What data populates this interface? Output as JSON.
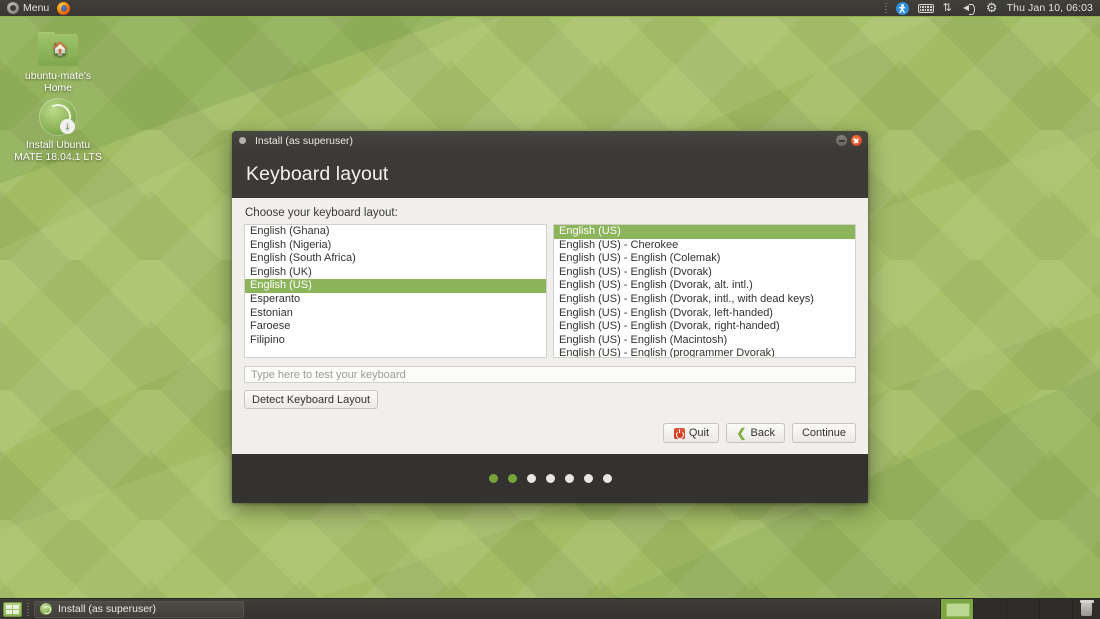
{
  "top_panel": {
    "menu_label": "Menu",
    "menu_icon": "mate-menu-icon",
    "firefox_icon": "firefox-icon",
    "tray": {
      "accessibility_icon": "accessibility-icon",
      "keyboard_icon": "keyboard-indicator-icon",
      "network_icon": "network-updown-icon",
      "volume_icon": "volume-icon",
      "settings_icon": "settings-gear-icon"
    },
    "clock": "Thu Jan 10, 06:03"
  },
  "desktop_icons": [
    {
      "name": "home-folder",
      "icon": "folder-home-icon",
      "label_line1": "ubuntu-mate's",
      "label_line2": "Home"
    },
    {
      "name": "install-launcher",
      "icon": "install-disc-icon",
      "label_line1": "Install Ubuntu",
      "label_line2": "MATE 18.04.1 LTS"
    }
  ],
  "installer": {
    "window_title": "Install (as superuser)",
    "titlebar_icons": {
      "minimize": "minimize-icon",
      "close": "close-icon"
    },
    "page_title": "Keyboard layout",
    "prompt": "Choose your keyboard layout:",
    "layouts": [
      {
        "label": "English (Ghana)",
        "selected": false
      },
      {
        "label": "English (Nigeria)",
        "selected": false
      },
      {
        "label": "English (South Africa)",
        "selected": false
      },
      {
        "label": "English (UK)",
        "selected": false
      },
      {
        "label": "English (US)",
        "selected": true
      },
      {
        "label": "Esperanto",
        "selected": false
      },
      {
        "label": "Estonian",
        "selected": false
      },
      {
        "label": "Faroese",
        "selected": false
      },
      {
        "label": "Filipino",
        "selected": false
      }
    ],
    "variants": [
      {
        "label": "English (US)",
        "selected": true
      },
      {
        "label": "English (US) - Cherokee",
        "selected": false
      },
      {
        "label": "English (US) - English (Colemak)",
        "selected": false
      },
      {
        "label": "English (US) - English (Dvorak)",
        "selected": false
      },
      {
        "label": "English (US) - English (Dvorak, alt. intl.)",
        "selected": false
      },
      {
        "label": "English (US) - English (Dvorak, intl., with dead keys)",
        "selected": false
      },
      {
        "label": "English (US) - English (Dvorak, left-handed)",
        "selected": false
      },
      {
        "label": "English (US) - English (Dvorak, right-handed)",
        "selected": false
      },
      {
        "label": "English (US) - English (Macintosh)",
        "selected": false
      },
      {
        "label": "English (US) - English (programmer Dvorak)",
        "selected": false
      }
    ],
    "test_input": {
      "value": "",
      "placeholder": "Type here to test your keyboard"
    },
    "detect_button": "Detect Keyboard Layout",
    "buttons": {
      "quit": "Quit",
      "back": "Back",
      "continue": "Continue",
      "quit_icon": "power-off-icon",
      "back_icon": "chevron-left-icon"
    },
    "progress_dots": {
      "total": 7,
      "active": 2
    }
  },
  "taskbar": {
    "show_desktop_icon": "show-desktop-icon",
    "task_label": "Install (as superuser)",
    "task_icon": "install-disc-icon",
    "workspaces": {
      "count": 4,
      "active": 1
    },
    "trash_icon": "trash-icon"
  },
  "colors": {
    "accent_green": "#8cb45a",
    "wallpaper_green": "#a3bd64",
    "window_dark": "#3b3a36",
    "window_body": "#f0efed",
    "close_orange": "#e8532b"
  }
}
